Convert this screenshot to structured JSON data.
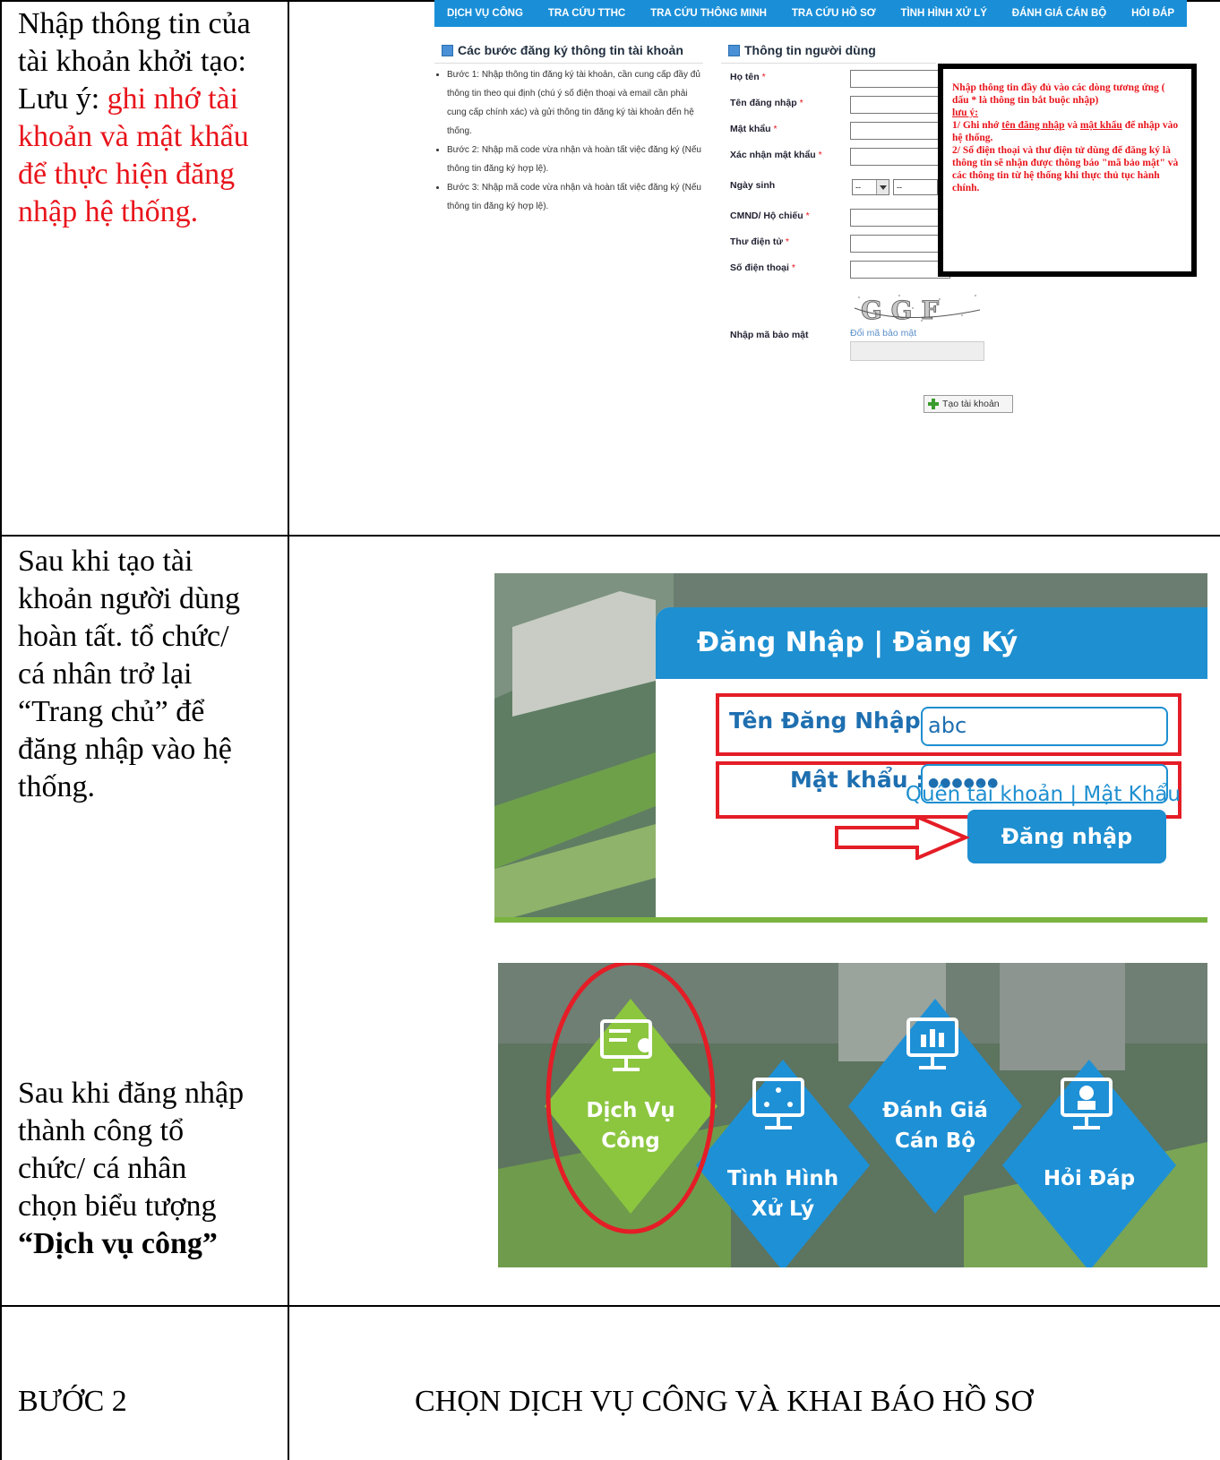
{
  "row1": {
    "left_text_black": "Nhập thông tin của tài khoản khởi tạo: Lưu ý: ",
    "left_line1": "Nhập thông tin của",
    "left_line2": "tài khoản khởi tạo:",
    "left_line3_black": "Lưu ý: ",
    "left_line3_red": "ghi nhớ tài",
    "left_line4_red": "khoản và mật khẩu",
    "left_line5_red": "để thực hiện đăng",
    "left_line6_red": "nhập hệ thống."
  },
  "registration": {
    "nav": [
      "DỊCH VỤ CÔNG",
      "TRA CỨU TTHC",
      "TRA CỨU THÔNG MINH",
      "TRA CỨU HỒ SƠ",
      "TÌNH HÌNH XỬ LÝ",
      "ĐÁNH GIÁ CÁN BỘ",
      "HỎI ĐÁP"
    ],
    "steps_title": "Các bước đăng ký thông tin tài khoản",
    "user_title": "Thông tin người dùng",
    "steps": [
      "Bước 1: Nhập thông tin đăng ký tài khoản, cần cung cấp đầy đủ thông tin theo qui định (chú ý số điện thoại và email cần phải cung cấp chính xác) và gửi thông tin đăng ký tài khoản đến hệ thống.",
      "Bước 2: Nhập mã code vừa nhận và hoàn tất việc đăng ký (Nếu thông tin đăng ký hợp lệ).",
      "Bước 3: Nhập mã code vừa nhận và hoàn tất việc đăng ký (Nếu thông tin đăng ký hợp lệ)."
    ],
    "fields": {
      "ho_ten": "Họ tên",
      "ten_dang_nhap": "Tên đăng nhập",
      "mat_khau": "Mật khẩu",
      "xac_nhan": "Xác nhận mật khẩu",
      "ngay_sinh": "Ngày sinh",
      "cmnd": "CMND/ Hộ chiếu",
      "thu_dien_tu": "Thư điện tử",
      "so_dien_thoai": "Số điện thoại",
      "ma_bao_mat": "Nhập mã bảo mật"
    },
    "required_mark": "*",
    "select_default": "--",
    "captcha_text": "G G F",
    "captcha_link": "Đổi mã bảo mật",
    "create_button": "Tạo tài khoản",
    "note": {
      "line1": "Nhập thông tin đầy đủ vào các dòng tương ứng ( dấu * là thông tin bắt buộc nhập)",
      "luu_y": "lưu ý:",
      "p1_a": "1/ Ghi nhớ ",
      "p1_u1": "tên đăng nhập",
      "p1_b": " và ",
      "p1_u2": "mật khẩu",
      "p1_c": " để nhập vào hệ thống.",
      "p2": "2/ Số điện thoại và thư điện tử dùng để đăng ký là thông tin sẽ nhận được thông báo \"mã bảo mật\" và các thông tin từ hệ thống khi thực thủ tục hành chính."
    }
  },
  "row2": {
    "left_lines": [
      "Sau khi tạo tài",
      "khoản người dùng",
      "hoàn tất. tổ chức/",
      "cá nhân trở lại",
      "“Trang chủ” để",
      "đăng nhập vào hệ",
      "thống."
    ],
    "left_lines_b": [
      "Sau khi đăng nhập",
      "thành công tổ",
      "chức/ cá nhân",
      "chọn biểu tượng"
    ],
    "left_bold": "“Dịch vụ công”"
  },
  "login": {
    "title": "Đăng Nhập | Đăng Ký",
    "username_label": "Tên Đăng Nhập :",
    "username_value": "abc",
    "password_label": "Mật khẩu :",
    "password_value": "●●●●●●",
    "forgot": "Quên tài khoản | Mật Khẩu",
    "button": "Đăng nhập"
  },
  "tiles": {
    "dich_vu_cong_1": "Dịch Vụ",
    "dich_vu_cong_2": "Công",
    "tinh_hinh_1": "Tình Hình",
    "tinh_hinh_2": "Xử Lý",
    "danh_gia_1": "Đánh Giá",
    "danh_gia_2": "Cán Bộ",
    "hoi_dap": "Hỏi Đáp"
  },
  "step2": {
    "label": "BƯỚC 2",
    "title": "CHỌN DỊCH VỤ CÔNG VÀ KHAI BÁO HỒ SƠ"
  },
  "colors": {
    "accent_blue": "#1e8fd0",
    "highlight_red": "#e41d26",
    "tile_green": "#8cc63f",
    "tile_blue": "#1e90d6"
  }
}
